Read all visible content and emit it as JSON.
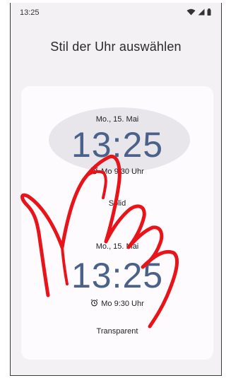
{
  "status_bar": {
    "time": "13:25",
    "icons": [
      "wifi-icon",
      "signal-icon",
      "battery-icon"
    ]
  },
  "page": {
    "title": "Stil der Uhr auswählen"
  },
  "clock_options": [
    {
      "date": "Mo., 15. Mai",
      "time": "13:25",
      "alarm": "Mo 9:30 Uhr",
      "label": "Solid",
      "selected": true
    },
    {
      "date": "Mo., 15. Mai",
      "time": "13:25",
      "alarm": "Mo 9:30 Uhr",
      "label": "Transparent",
      "selected": false
    }
  ],
  "colors": {
    "clock_digits": "#4a628a",
    "scribble": "#e8141a",
    "card": "#fdfbfd",
    "screen_bg": "#f4f1f4"
  }
}
